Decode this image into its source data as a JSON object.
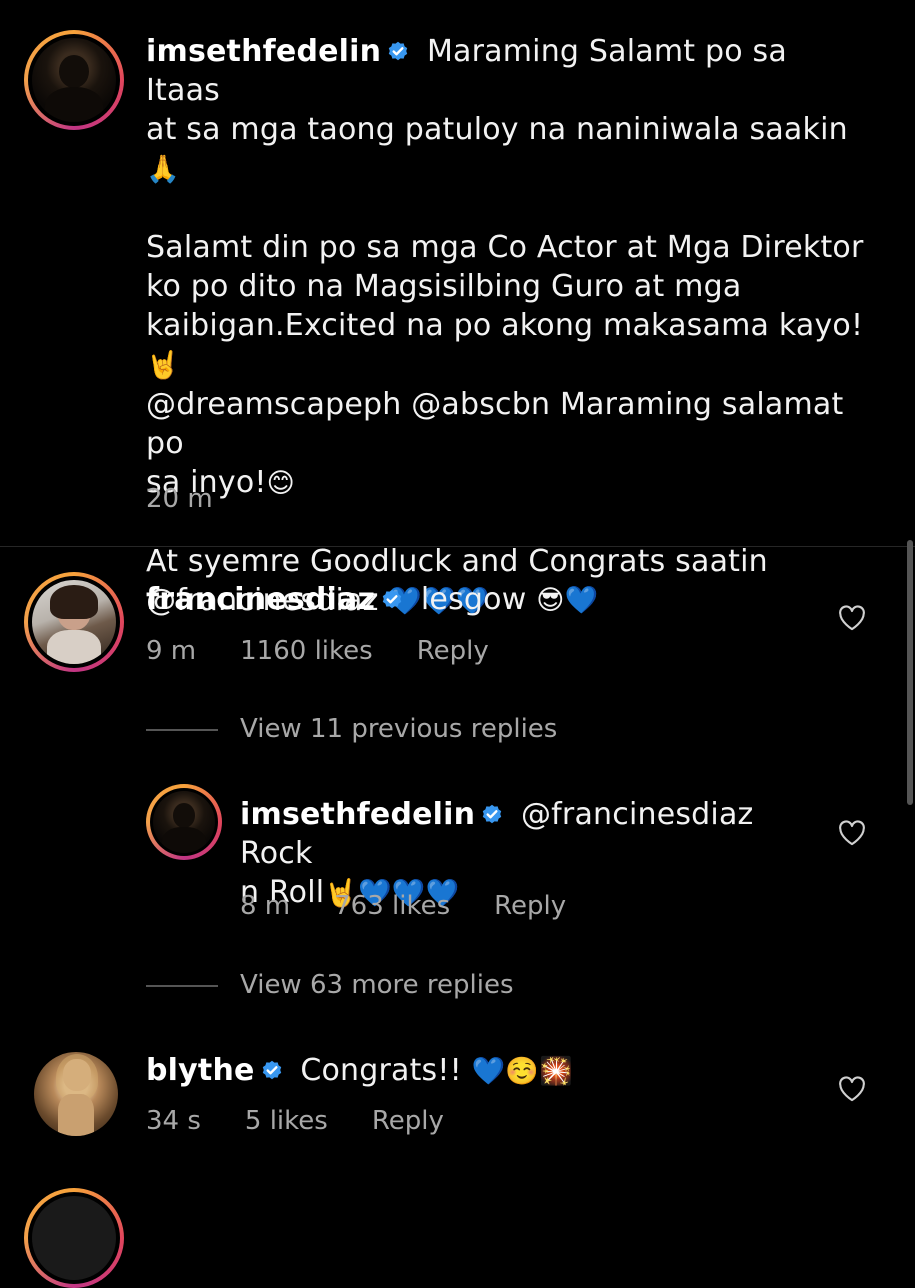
{
  "post": {
    "username": "imsethfedelin",
    "caption_line1": "Maraming Salamt po sa Itaas",
    "caption_line2": "at sa mga taong patuloy na naniniwala saakin",
    "caption_line2_emoji": "🙏",
    "caption_line3": "Salamt din po sa mga Co Actor at Mga Direktor",
    "caption_line4": "ko po dito na Magsisilbing Guro at mga",
    "caption_line5": "kaibigan.Excited na po akong makasama kayo!",
    "caption_line5_emoji": "🤘",
    "caption_mention1": "@dreamscapeph",
    "caption_mention2": "@abscbn",
    "caption_line6_rest": "Maraming salamat po",
    "caption_line7": "sa inyo!",
    "caption_line7_emoji": "😊",
    "caption_line8": "At syemre Goodluck and Congrats saatin",
    "caption_mention3": "@francinesdiaz",
    "caption_line9_emoji": "💙💙💙",
    "time": "20 m"
  },
  "comments": [
    {
      "username": "francinesdiaz",
      "text": "lesgow",
      "emoji": "😎💙",
      "time": "9 m",
      "likes": "1160 likes",
      "reply": "Reply"
    },
    {
      "username": "blythe",
      "text": "Congrats!!",
      "emoji": "💙☺️🎇",
      "time": "34 s",
      "likes": "5 likes",
      "reply": "Reply"
    }
  ],
  "reply_thread": {
    "view_previous": "View 11 previous replies",
    "view_more": "View 63 more replies",
    "reply": {
      "username": "imsethfedelin",
      "mention": "@francinesdiaz",
      "text_line1_rest": "Rock",
      "text_line2": "n Roll",
      "emoji": "🤘💙💙💙",
      "time": "8 m",
      "likes": "763 likes",
      "reply": "Reply"
    }
  },
  "icons": {
    "verified": "verified-badge-icon",
    "heart": "heart-outline-icon"
  },
  "colors": {
    "background": "#000000",
    "verified_blue": "#3897f0",
    "meta_gray": "#a8a8a8"
  }
}
